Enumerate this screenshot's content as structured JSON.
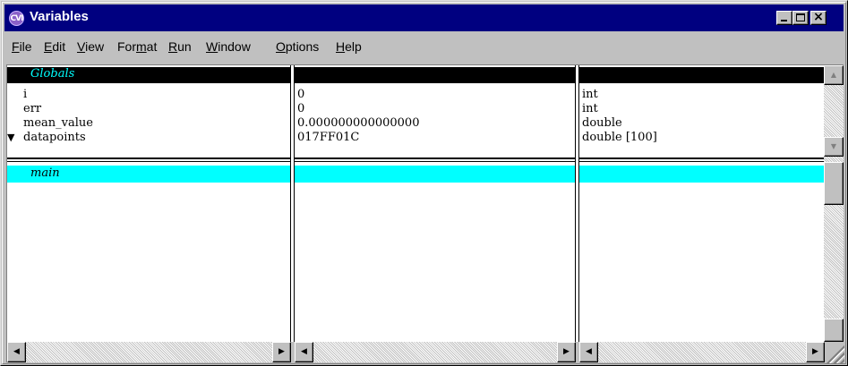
{
  "window": {
    "title": "Variables",
    "icon_label": "CVI"
  },
  "menu": {
    "items": [
      {
        "label": "File",
        "underline": "F",
        "rest": "ile"
      },
      {
        "label": "Edit",
        "underline": "E",
        "rest": "dit"
      },
      {
        "label": "View",
        "underline": "V",
        "rest": "iew"
      },
      {
        "label": "Format",
        "pre": "For",
        "underline": "m",
        "rest": "at"
      },
      {
        "label": "Run",
        "underline": "R",
        "rest": "un"
      },
      {
        "label": "Window",
        "underline": "W",
        "rest": "indow"
      },
      {
        "label": "Options",
        "underline": "O",
        "rest": "ptions"
      },
      {
        "label": "Help",
        "underline": "H",
        "rest": "elp"
      }
    ]
  },
  "globals": {
    "section_label": "Globals",
    "rows": [
      {
        "name": "i",
        "value": "0",
        "type": "int",
        "expandable": false
      },
      {
        "name": "err",
        "value": "0",
        "type": "int",
        "expandable": false
      },
      {
        "name": "mean_value",
        "value": "0.000000000000000",
        "type": "double",
        "expandable": false
      },
      {
        "name": "datapoints",
        "value": "017FF01C",
        "type": "double [100]",
        "expandable": true
      }
    ]
  },
  "main_section": {
    "label": "main"
  },
  "icons": {
    "expand": "▼",
    "scroll_up": "▲",
    "scroll_down": "▼",
    "scroll_left": "◀",
    "scroll_right": "▶",
    "minimize": "_",
    "close": "×"
  },
  "colors": {
    "titlebar": "#000080",
    "globals_text": "#00ffff",
    "main_highlight": "#00ffff"
  }
}
